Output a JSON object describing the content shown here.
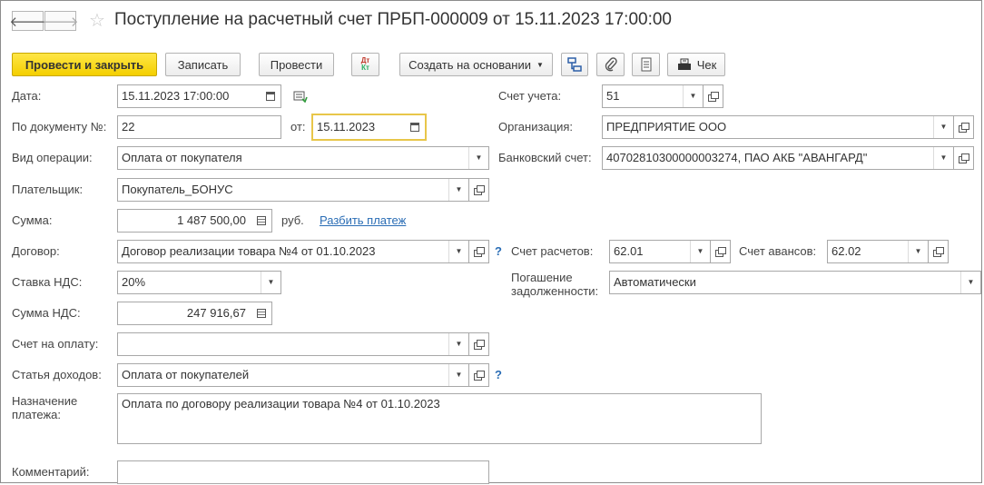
{
  "title": "Поступление на расчетный счет ПРБП-000009 от 15.11.2023 17:00:00",
  "nav": {
    "back": "🡐",
    "forward": "🡒"
  },
  "toolbar": {
    "post_close": "Провести и закрыть",
    "save": "Записать",
    "post": "Провести",
    "dtkt": "Дт Кт",
    "create_based": "Создать на основании",
    "check": "Чек"
  },
  "left": {
    "date_label": "Дата:",
    "date_value": "15.11.2023 17:00:00",
    "docnum_label": "По документу №:",
    "docnum_value": "22",
    "from_label": "от:",
    "from_value": "15.11.2023",
    "optype_label": "Вид операции:",
    "optype_value": "Оплата от покупателя",
    "payer_label": "Плательщик:",
    "payer_value": "Покупатель_БОНУС",
    "sum_label": "Сумма:",
    "sum_value": "1 487 500,00",
    "currency": "руб.",
    "split_link": "Разбить платеж",
    "contract_label": "Договор:",
    "contract_value": "Договор реализации товара №4 от 01.10.2023",
    "vat_rate_label": "Ставка НДС:",
    "vat_rate_value": "20%",
    "vat_sum_label": "Сумма НДС:",
    "vat_sum_value": "247 916,67",
    "invoice_label": "Счет на оплату:",
    "invoice_value": "",
    "income_label": "Статья доходов:",
    "income_value": "Оплата от покупателей",
    "purpose_label_1": "Назначение",
    "purpose_label_2": "платежа:",
    "purpose_value": "Оплата по договору реализации товара №4 от 01.10.2023",
    "comment_label": "Комментарий:",
    "comment_value": ""
  },
  "right": {
    "account_label": "Счет учета:",
    "account_value": "51",
    "org_label": "Организация:",
    "org_value": "ПРЕДПРИЯТИЕ ООО",
    "bank_label": "Банковский счет:",
    "bank_value": "40702810300000003274, ПАО АКБ \"АВАНГАРД\"",
    "settle_label": "Счет расчетов:",
    "settle_value": "62.01",
    "advance_label": "Счет авансов:",
    "advance_value": "62.02",
    "debt_label_1": "Погашение",
    "debt_label_2": "задолженности:",
    "debt_value": "Автоматически"
  },
  "help": "?",
  "colors": {
    "primary_button": "#f4cf00",
    "focus_border": "#e8c64a",
    "link": "#2a6db5"
  }
}
